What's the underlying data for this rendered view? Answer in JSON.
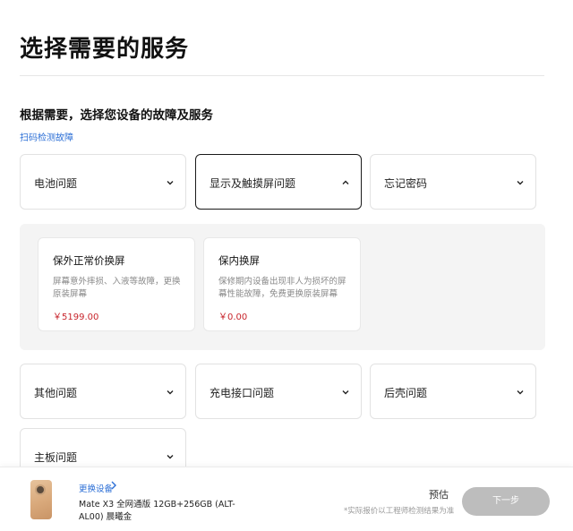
{
  "page_title": "选择需要的服务",
  "subtitle": "根据需要，选择您设备的故障及服务",
  "scan_link": "扫码检测故障",
  "categories_top": [
    {
      "label": "电池问题",
      "expanded": false
    },
    {
      "label": "显示及触摸屏问题",
      "expanded": true
    },
    {
      "label": "忘记密码",
      "expanded": false
    }
  ],
  "services": [
    {
      "name": "保外正常价换屏",
      "desc": "屏幕意外摔损、入液等故障，更换原装屏幕",
      "price": "￥5199.00"
    },
    {
      "name": "保内换屏",
      "desc": "保修期内设备出现非人为损坏的屏幕性能故障，免费更换原装屏幕",
      "price": "￥0.00"
    }
  ],
  "categories_bottom": [
    {
      "label": "其他问题"
    },
    {
      "label": "充电接口问题"
    },
    {
      "label": "后壳问题"
    },
    {
      "label": "主板问题"
    }
  ],
  "bottom_bar": {
    "change_device": "更换设备",
    "device_name": "Mate X3 全网通版 12GB+256GB (ALT-AL00) 晨曦金",
    "estimate_label": "预估",
    "estimate_note": "*实际报价以工程师检测结果为准",
    "next_label": "下一步"
  },
  "colors": {
    "link": "#2c6fd6",
    "price": "#c8252c",
    "panel_bg": "#f4f4f4",
    "next_disabled": "#bdbdbd"
  },
  "icons": {
    "collapsed": "chevron-down-icon",
    "expanded": "chevron-up-icon",
    "link_arrow": "chevron-right-icon"
  }
}
